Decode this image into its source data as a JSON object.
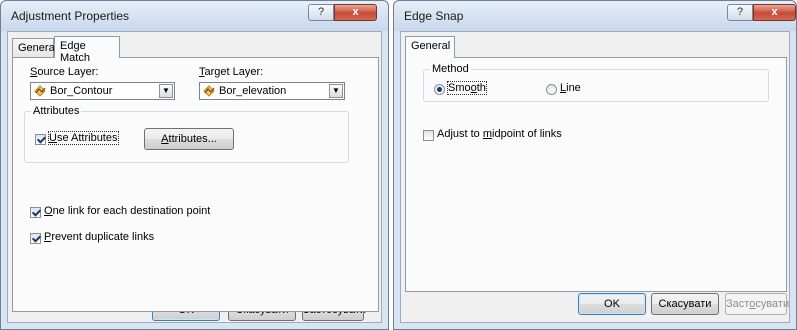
{
  "adjustment_dialog": {
    "title": "Adjustment Properties",
    "tabs": [
      "General",
      "Edge Match"
    ],
    "source_layer": {
      "label_u": "S",
      "label_rest": "ource Layer:",
      "value": "Bor_Contour"
    },
    "target_layer": {
      "label_u": "T",
      "label_rest": "arget Layer:",
      "value": "Bor_elevation"
    },
    "attributes_group": "Attributes",
    "use_attributes": {
      "label_u": "U",
      "label_rest": "se Attributes",
      "checked": true
    },
    "attributes_button": {
      "label_u": "A",
      "label_rest": "ttributes..."
    },
    "one_link": {
      "label_u": "O",
      "label_rest": "ne link for each destination point",
      "checked": true
    },
    "prevent_duplicate": {
      "label_u": "P",
      "label_rest": "revent duplicate links",
      "checked": true
    },
    "buttons": {
      "ok": "OK",
      "cancel": "Скасувати",
      "apply": "Застосувати"
    }
  },
  "edge_snap_dialog": {
    "title": "Edge Snap",
    "tabs": [
      "General"
    ],
    "method_group": "Method",
    "smooth": {
      "label_pre": "Smo",
      "label_u": "o",
      "label_rest": "th",
      "selected": true
    },
    "line": {
      "label_u": "L",
      "label_rest": "ine",
      "selected": false
    },
    "adjust_midpoint": {
      "label_pre": "Adjust to ",
      "label_u": "m",
      "label_rest": "idpoint of links",
      "checked": false
    },
    "buttons": {
      "ok": "OK",
      "cancel": "Скасувати",
      "apply_pre": "Заст",
      "apply_u": "о",
      "apply_rest": "сувати"
    }
  },
  "colors": {
    "frame": "#d7e4f2",
    "client": "#f0f0f0",
    "close_button": "#c74a36",
    "check_mark": "#1d3a6e"
  },
  "icons": {
    "title_help": "?",
    "title_close": "x",
    "combo_arrow": "▼",
    "layer_icon": "polyline-layer-icon"
  }
}
